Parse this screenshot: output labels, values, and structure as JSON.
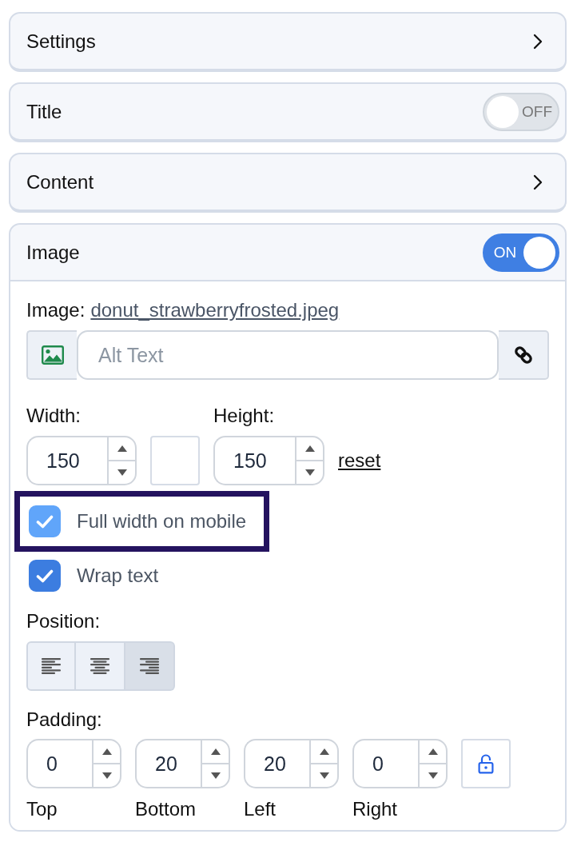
{
  "sections": [
    {
      "kind": "chevron",
      "title": "Settings"
    },
    {
      "kind": "switch",
      "title": "Title",
      "switch": {
        "on": false,
        "label": "OFF"
      }
    },
    {
      "kind": "chevron",
      "title": "Content"
    },
    {
      "kind": "switch",
      "title": "Image",
      "switch": {
        "on": true,
        "label": "ON"
      },
      "body": {
        "file": {
          "label": "Image:",
          "name": "donut_strawberryfrosted.jpeg"
        },
        "alt_text": {
          "placeholder": "Alt Text"
        },
        "dimensions": {
          "width": {
            "label": "Width:",
            "value": "150"
          },
          "height": {
            "label": "Height:",
            "value": "150"
          },
          "reset": "reset"
        },
        "options": [
          {
            "label": "Full width on mobile",
            "checked": true,
            "focused": true
          },
          {
            "label": "Wrap text",
            "checked": true,
            "focused": false
          }
        ],
        "position": {
          "label": "Position:",
          "options": [
            {
              "kind": "left",
              "selected": false
            },
            {
              "kind": "center",
              "selected": false
            },
            {
              "kind": "right",
              "selected": true
            }
          ]
        },
        "padding": {
          "label": "Padding:",
          "locked": false,
          "fields": [
            {
              "value": "0",
              "label": "Top"
            },
            {
              "value": "20",
              "label": "Bottom"
            },
            {
              "value": "20",
              "label": "Left"
            },
            {
              "value": "0",
              "label": "Right"
            }
          ]
        }
      }
    }
  ]
}
